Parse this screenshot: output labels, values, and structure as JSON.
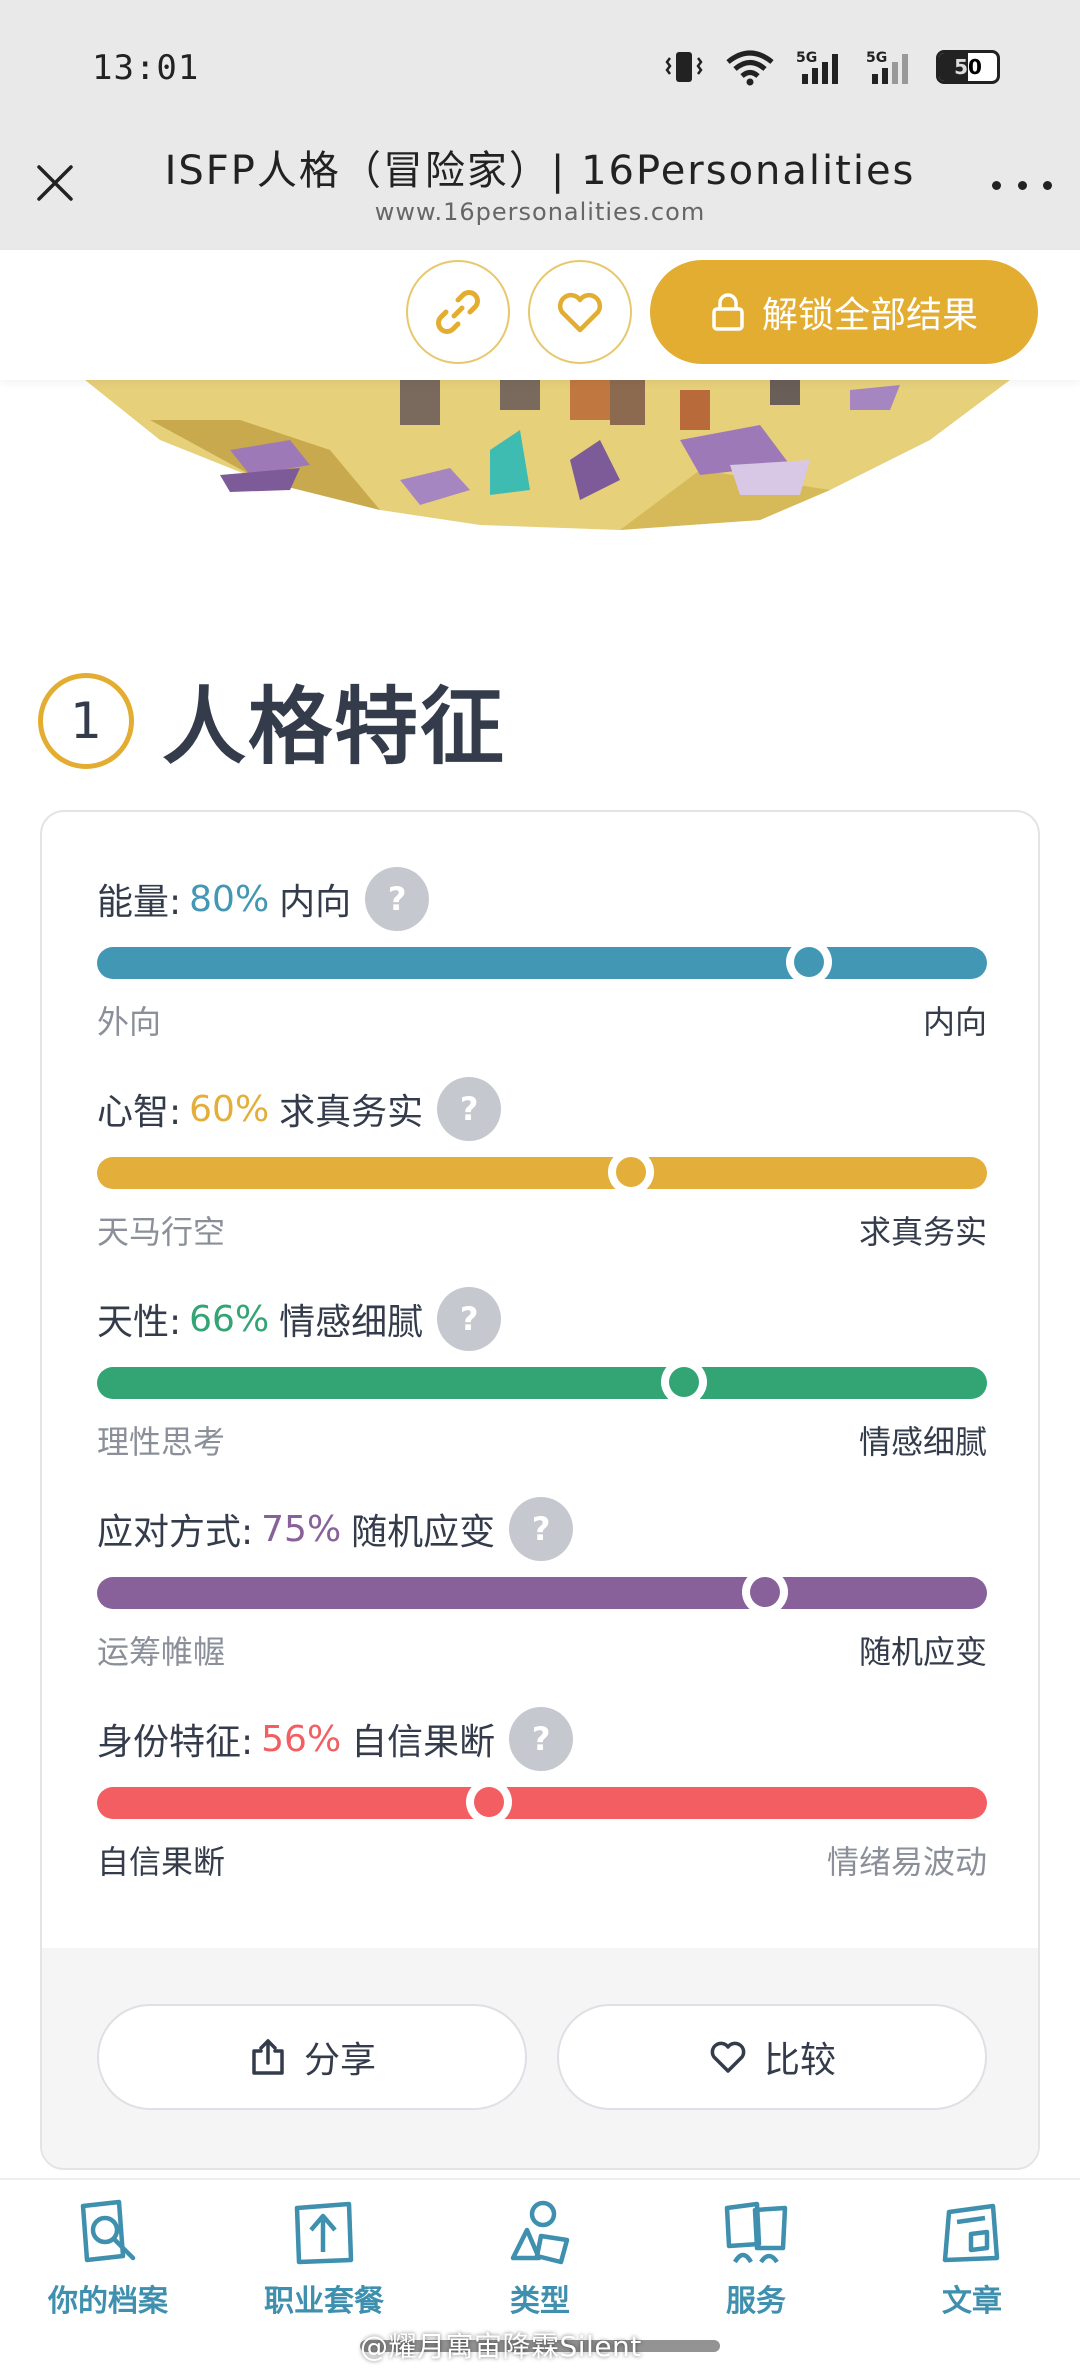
{
  "status_bar": {
    "time": "13:01",
    "battery": "50"
  },
  "browser": {
    "title": "ISFP人格（冒险家）| 16Personalities",
    "url": "www.16personalities.com"
  },
  "actions": {
    "unlock_label": "解锁全部结果"
  },
  "section": {
    "number": "1",
    "title": "人格特征"
  },
  "traits": [
    {
      "name": "能量:",
      "percent": "80%",
      "label": "内向",
      "left": "外向",
      "right": "内向",
      "value": 0.8,
      "color": "#4298b4",
      "strong_side": "right"
    },
    {
      "name": "心智:",
      "percent": "60%",
      "label": "求真务实",
      "left": "天马行空",
      "right": "求真务实",
      "value": 0.6,
      "color": "#e4ae3a",
      "strong_side": "right"
    },
    {
      "name": "天性:",
      "percent": "66%",
      "label": "情感细腻",
      "left": "理性思考",
      "right": "情感细腻",
      "value": 0.66,
      "color": "#33a474",
      "strong_side": "right"
    },
    {
      "name": "应对方式:",
      "percent": "75%",
      "label": "随机应变",
      "left": "运筹帷幄",
      "right": "随机应变",
      "value": 0.75,
      "color": "#88619a",
      "strong_side": "right"
    },
    {
      "name": "身份特征:",
      "percent": "56%",
      "label": "自信果断",
      "left": "自信果断",
      "right": "情绪易波动",
      "value": 0.44,
      "color": "#f25e62",
      "strong_side": "left"
    }
  ],
  "help_mark": "?",
  "card_actions": {
    "share_label": "分享",
    "compare_label": "比较"
  },
  "bottom_nav": [
    {
      "label": "你的档案",
      "icon": "profile-search-icon"
    },
    {
      "label": "职业套餐",
      "icon": "career-arrow-icon"
    },
    {
      "label": "类型",
      "icon": "types-shapes-icon"
    },
    {
      "label": "服务",
      "icon": "services-people-icon"
    },
    {
      "label": "文章",
      "icon": "articles-icon"
    }
  ],
  "watermark": "@耀月寓宙降霖Silent",
  "colors": {
    "accent": "#e3ad31",
    "nav": "#3f8fae",
    "text": "#343c4b"
  }
}
